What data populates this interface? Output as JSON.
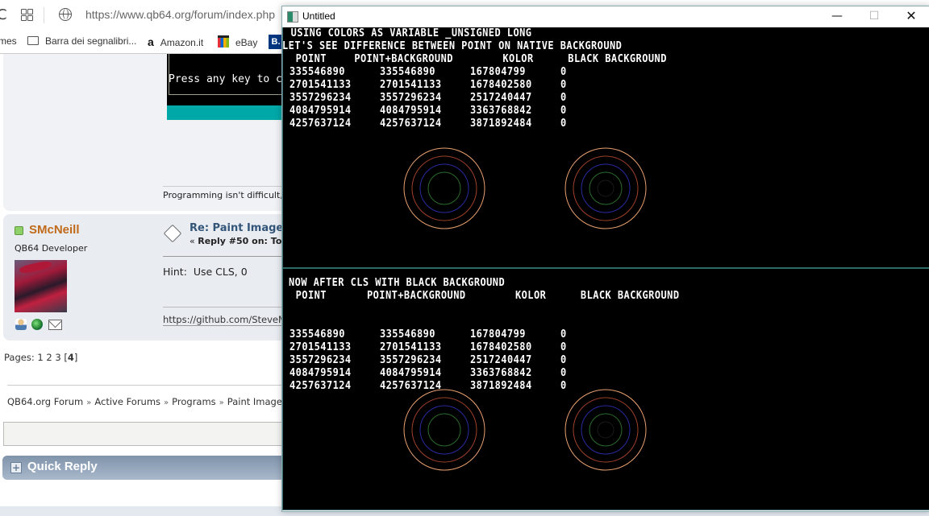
{
  "browser": {
    "url": "https://www.qb64.org/forum/index.php",
    "bookmarks": [
      {
        "label": "mes",
        "icon": "none"
      },
      {
        "label": "Barra dei segnalibri...",
        "icon": "folder-icon"
      },
      {
        "label": "Amazon.it",
        "icon": "amazon-icon"
      },
      {
        "label": "eBay",
        "icon": "ebay-icon"
      },
      {
        "label": "B.",
        "icon": "booking-icon"
      }
    ]
  },
  "forum": {
    "embedded_screenshot_text": "Press any key to c",
    "signature_1": "Programming isn't difficult,",
    "post": {
      "username": "SMcNeill",
      "user_title": "QB64 Developer",
      "subject": "Re: Paint Image",
      "meta_prefix": "«",
      "meta": "Reply #50 on: To",
      "body": "Hint:  Use CLS, 0",
      "signature_link": "https://github.com/SteveM"
    },
    "pages": {
      "label": "Pages:",
      "items": [
        "1",
        "2",
        "3"
      ],
      "current": "4"
    },
    "breadcrumb": [
      "QB64.org Forum",
      "Active Forums",
      "Programs",
      "Paint Image"
    ],
    "breadcrumb_sep": "»",
    "quick_reply": "Quick Reply",
    "quick_reply_icon": "+"
  },
  "window": {
    "title": "Untitled",
    "buttons": {
      "minimize": "—",
      "maximize": "☐",
      "close": "✕"
    },
    "top": {
      "line1": " USING COLORS AS VARIABLE _UNSIGNED LONG",
      "line2": "LET'S SEE DIFFERENCE BETWEEN POINT ON NATIVE BACKGROUND",
      "headers": [
        "POINT",
        "POINT+BACKGROUND",
        "KOLOR",
        "BLACK BACKGROUND"
      ],
      "rows": [
        [
          "335546890",
          "335546890",
          "167804799",
          "0"
        ],
        [
          "2701541133",
          "2701541133",
          "1678402580",
          "0"
        ],
        [
          "3557296234",
          "3557296234",
          "2517240447",
          "0"
        ],
        [
          "4084795914",
          "4084795914",
          "3363768842",
          "0"
        ],
        [
          "4257637124",
          "4257637124",
          "3871892484",
          "0"
        ]
      ]
    },
    "bottom": {
      "line1": "NOW AFTER CLS WITH BLACK BACKGROUND",
      "headers": [
        "POINT",
        "POINT+BACKGROUND",
        "KOLOR",
        "BLACK BACKGROUND"
      ],
      "rows": [
        [
          "335546890",
          "335546890",
          "167804799",
          "0"
        ],
        [
          "2701541133",
          "2701541133",
          "1678402580",
          "0"
        ],
        [
          "3557296234",
          "3557296234",
          "2517240447",
          "0"
        ],
        [
          "4084795914",
          "4084795914",
          "3363768842",
          "0"
        ],
        [
          "4257637124",
          "4257637124",
          "3871892484",
          "0"
        ]
      ]
    },
    "ring_colors": [
      "#e8a070",
      "#a0402a",
      "#2a2aa0",
      "#2a6a2a",
      "#1a1a1a"
    ]
  }
}
